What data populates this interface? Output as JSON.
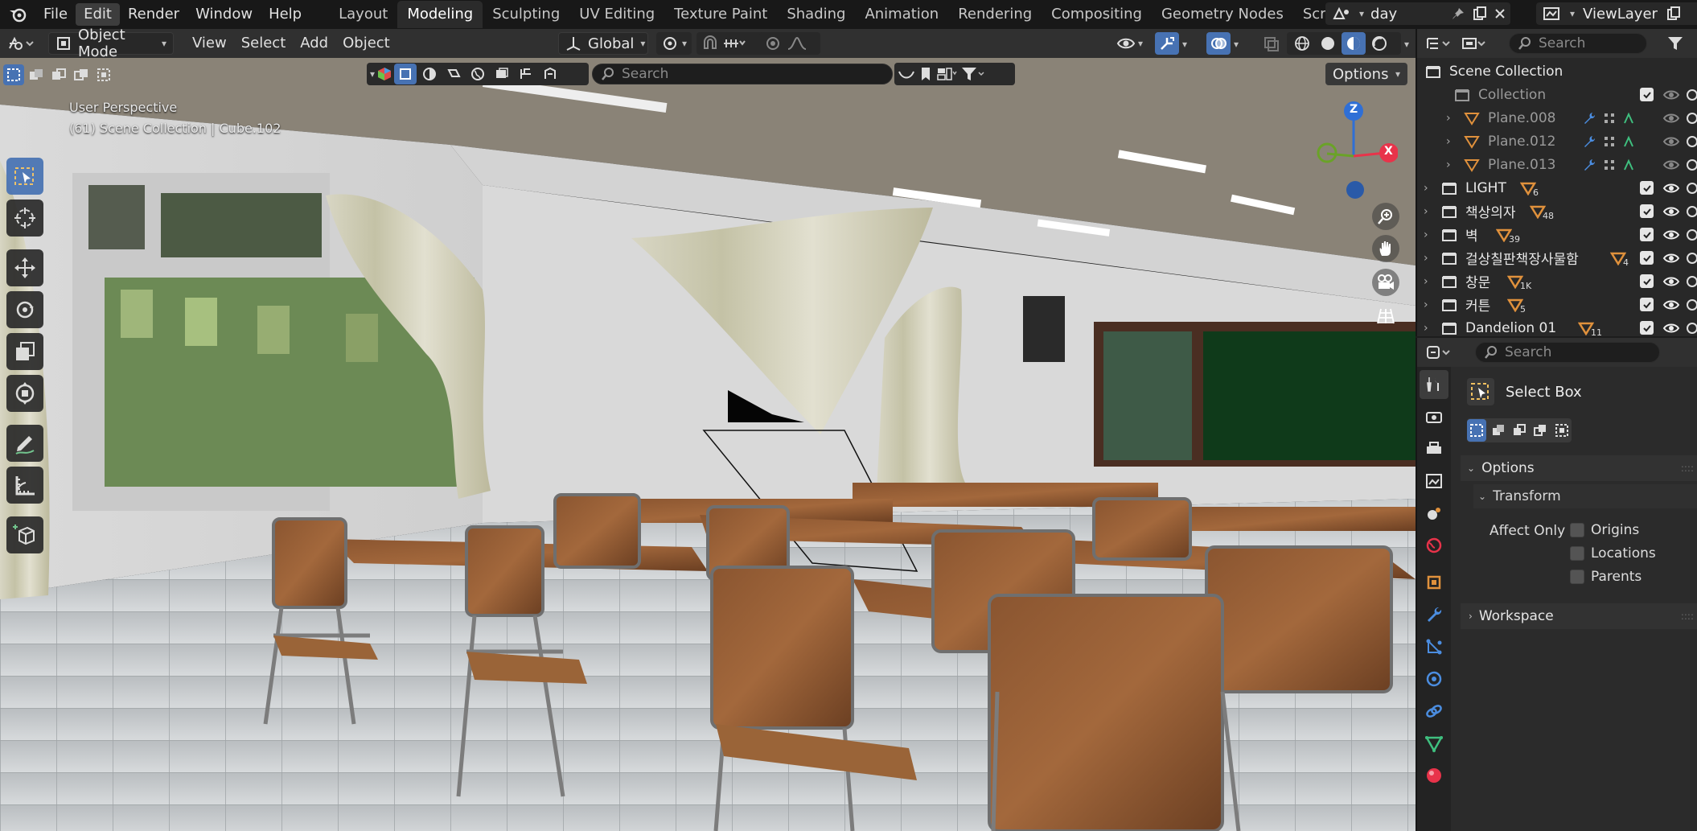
{
  "menu": {
    "file": "File",
    "edit": "Edit",
    "render": "Render",
    "window": "Window",
    "help": "Help"
  },
  "workspaces": [
    "Layout",
    "Modeling",
    "Sculpting",
    "UV Editing",
    "Texture Paint",
    "Shading",
    "Animation",
    "Rendering",
    "Compositing",
    "Geometry Nodes",
    "Scripting"
  ],
  "active_workspace": "Modeling",
  "scene_name": "day",
  "view_layer": "ViewLayer",
  "viewport_header": {
    "mode": "Object Mode",
    "view": "View",
    "select": "Select",
    "add": "Add",
    "object": "Object",
    "transform_orientation": "Global"
  },
  "tool_row": {
    "search_placeholder": "Search",
    "options_label": "Options"
  },
  "viewport": {
    "perspective": "User Perspective",
    "context": "(61) Scene Collection | Cube.102",
    "gizmo": {
      "x": "X",
      "z": "Z"
    }
  },
  "outliner": {
    "search_placeholder": "Search",
    "root": "Scene Collection",
    "rows": [
      {
        "name": "Collection",
        "dim": true,
        "count": ""
      },
      {
        "name": "Plane.008",
        "dim": true,
        "count": ""
      },
      {
        "name": "Plane.012",
        "dim": true,
        "count": ""
      },
      {
        "name": "Plane.013",
        "dim": true,
        "count": ""
      },
      {
        "name": "LIGHT",
        "dim": false,
        "count": "6"
      },
      {
        "name": "책상의자",
        "dim": false,
        "count": "48"
      },
      {
        "name": "벽",
        "dim": false,
        "count": "39"
      },
      {
        "name": "걸상칠판책장사물함",
        "dim": false,
        "count": "4"
      },
      {
        "name": "창문",
        "dim": false,
        "count": "1K"
      },
      {
        "name": "커튼",
        "dim": false,
        "count": "5"
      },
      {
        "name": "Dandelion 01",
        "dim": false,
        "count": "11"
      }
    ]
  },
  "properties": {
    "search_placeholder": "Search",
    "tool_name": "Select Box",
    "options_panel": "Options",
    "transform_panel": "Transform",
    "affect_only": "Affect Only",
    "origins": "Origins",
    "locations": "Locations",
    "parents": "Parents",
    "workspace_panel": "Workspace"
  },
  "colors": {
    "accent": "#4772b3",
    "object_orange": "#e0913c",
    "axis_x": "#e8334a",
    "axis_y": "#6aa228",
    "axis_z": "#2f6fd6"
  }
}
